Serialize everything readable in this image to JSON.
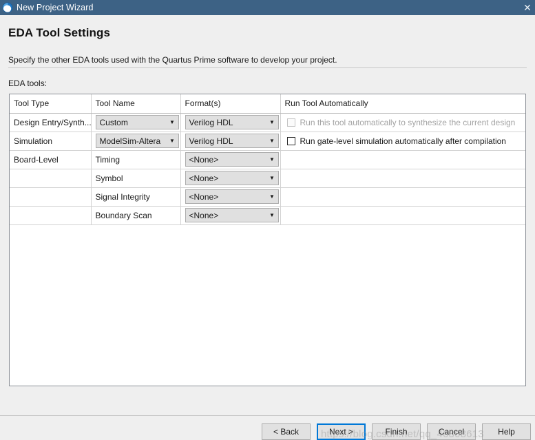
{
  "window": {
    "title": "New Project Wizard",
    "icon": "quartus-logo-icon",
    "close_label": "✕"
  },
  "page": {
    "title": "EDA Tool Settings",
    "description": "Specify the other EDA tools used with the Quartus Prime software to develop your project.",
    "section_label": "EDA tools:"
  },
  "table": {
    "columns": [
      "Tool Type",
      "Tool Name",
      "Format(s)",
      "Run Tool Automatically"
    ],
    "rows": [
      {
        "tool_type": "Design Entry/Synth...",
        "tool_name": "Custom",
        "tool_name_kind": "combo",
        "format": "Verilog HDL",
        "format_kind": "combo",
        "auto_kind": "checkbox",
        "auto_label": "Run this tool automatically to synthesize the current design",
        "auto_checked": false,
        "auto_disabled": true
      },
      {
        "tool_type": "Simulation",
        "tool_name": "ModelSim-Altera",
        "tool_name_kind": "combo",
        "format": "Verilog HDL",
        "format_kind": "combo",
        "auto_kind": "checkbox",
        "auto_label": "Run gate-level simulation automatically after compilation",
        "auto_checked": false,
        "auto_disabled": false
      },
      {
        "tool_type": "Board-Level",
        "tool_name": "Timing",
        "tool_name_kind": "text",
        "format": "<None>",
        "format_kind": "combo",
        "auto_kind": "none",
        "auto_label": "",
        "auto_checked": false,
        "auto_disabled": false
      },
      {
        "tool_type": "",
        "tool_name": "Symbol",
        "tool_name_kind": "text",
        "format": "<None>",
        "format_kind": "combo",
        "auto_kind": "none",
        "auto_label": "",
        "auto_checked": false,
        "auto_disabled": false
      },
      {
        "tool_type": "",
        "tool_name": "Signal Integrity",
        "tool_name_kind": "text",
        "format": "<None>",
        "format_kind": "combo",
        "auto_kind": "none",
        "auto_label": "",
        "auto_checked": false,
        "auto_disabled": false
      },
      {
        "tool_type": "",
        "tool_name": "Boundary Scan",
        "tool_name_kind": "text",
        "format": "<None>",
        "format_kind": "combo",
        "auto_kind": "none",
        "auto_label": "",
        "auto_checked": false,
        "auto_disabled": false
      }
    ],
    "combo_arrow": "▼"
  },
  "footer": {
    "buttons": [
      {
        "label": "< Back",
        "focused": false
      },
      {
        "label": "Next >",
        "focused": true
      },
      {
        "label": "Finish",
        "focused": false
      },
      {
        "label": "Cancel",
        "focused": false
      },
      {
        "label": "Help",
        "focused": false
      }
    ]
  },
  "watermark": {
    "text": "https://blog.csdn.net/qq_46308613"
  },
  "colors": {
    "titlebar": "#3d6285",
    "dialog_bg": "#efefef",
    "focus_blue": "#0078d7",
    "combo_bg": "#e0e0e0",
    "disabled_text": "#a3a3a3"
  }
}
